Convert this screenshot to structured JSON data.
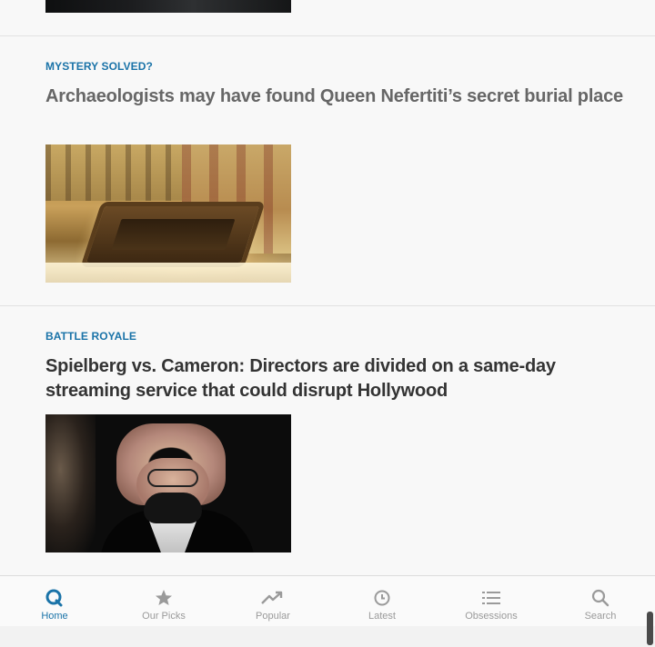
{
  "articles": [
    {
      "kicker": "MYSTERY SOLVED?",
      "headline": "Archaeologists may have found Queen Nefertiti’s secret burial place"
    },
    {
      "kicker": "BATTLE ROYALE",
      "headline": "Spielberg vs. Cameron: Directors are divided on a same-day streaming service that could disrupt Hollywood"
    }
  ],
  "nav": {
    "active": "Home",
    "accent_color": "#1a73a8",
    "inactive_color": "#9a9a9a",
    "items": [
      {
        "label": "Home",
        "icon": "quartz-q-icon"
      },
      {
        "label": "Our Picks",
        "icon": "star-icon"
      },
      {
        "label": "Popular",
        "icon": "trending-icon"
      },
      {
        "label": "Latest",
        "icon": "clock-icon"
      },
      {
        "label": "Obsessions",
        "icon": "list-icon"
      },
      {
        "label": "Search",
        "icon": "search-icon"
      }
    ]
  }
}
